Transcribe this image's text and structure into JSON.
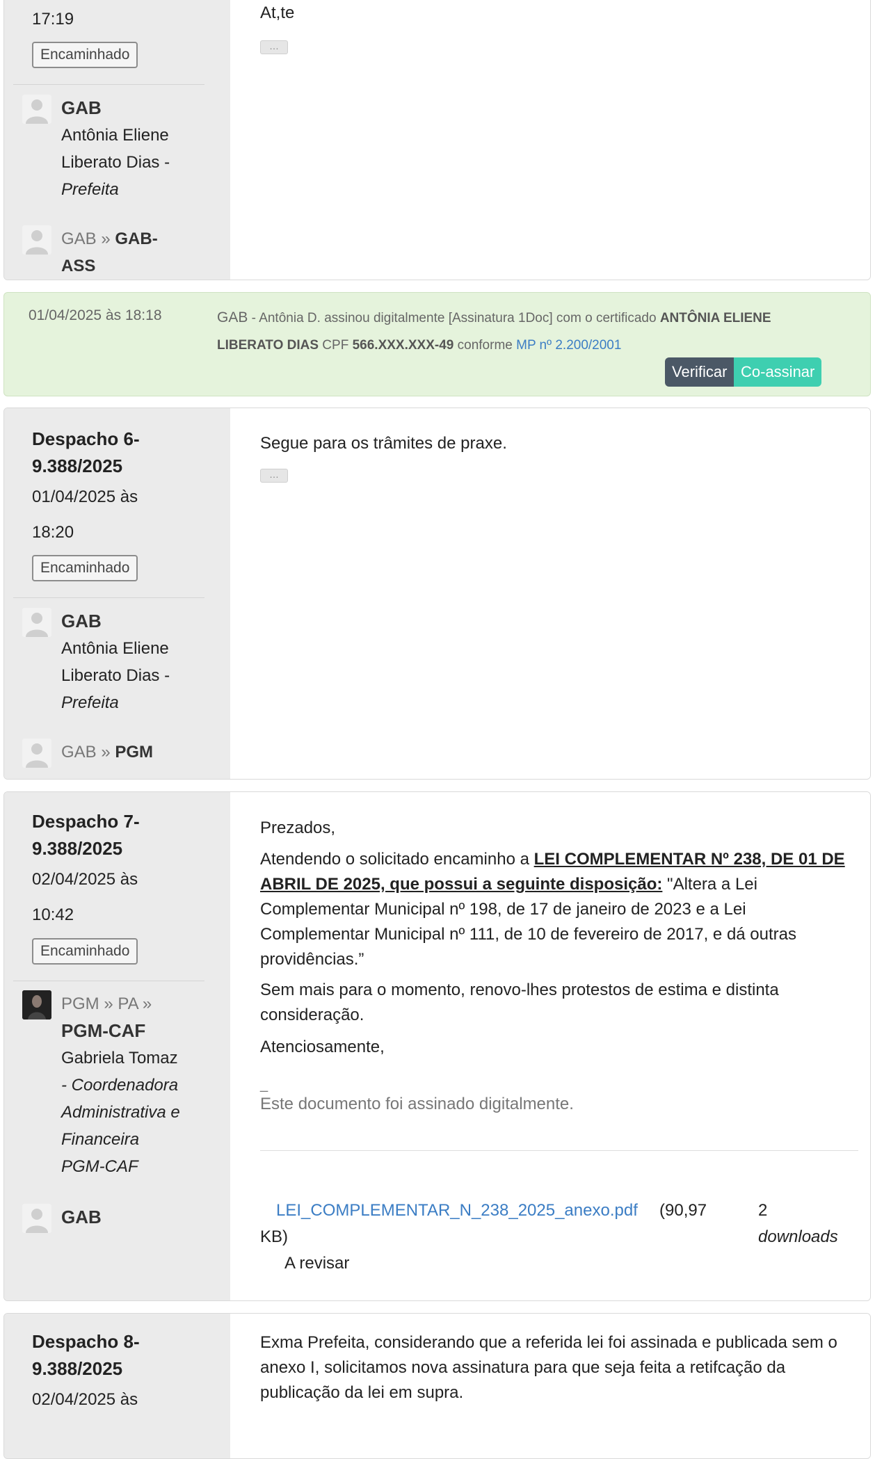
{
  "card1": {
    "time": "17:19",
    "badge": "Encaminhado",
    "sender_unit": "GAB",
    "sender_name_l1": "Antônia Eliene",
    "sender_name_l2": "Liberato Dias -",
    "sender_role": "Prefeita",
    "route_from": "GAB »",
    "route_to_l1": "GAB-",
    "route_to_l2": "ASS",
    "body_signoff": "At,te",
    "ellipsis": "…"
  },
  "signature": {
    "datetime": "01/04/2025 às 18:18",
    "unit": "GAB",
    "text_a": " - Antônia D. assinou digitalmente [Assinatura 1Doc] com o certificado ",
    "cert_name_l1": "ANTÔNIA ELIENE",
    "cert_name_l2": "LIBERATO DIAS",
    "cpf_label": " CPF ",
    "cpf": "566.XXX.XXX-49",
    "conforme": " conforme ",
    "mp_link": "MP nº 2.200/2001",
    "verify_button": "Verificar",
    "cosign_button": "Co-assinar",
    "colors": {
      "verify": "#4b5866",
      "cosign": "#3ecfb0",
      "background": "#e5f3dc"
    }
  },
  "card2": {
    "title_l1": "Despacho 6-",
    "title_l2": "9.388/2025",
    "date": "01/04/2025 às",
    "time": "18:20",
    "badge": "Encaminhado",
    "sender_unit": "GAB",
    "sender_name_l1": "Antônia Eliene",
    "sender_name_l2": "Liberato Dias -",
    "sender_role": "Prefeita",
    "route_from": "GAB »",
    "route_to": "PGM",
    "body": "Segue para os trâmites de praxe.",
    "ellipsis": "…"
  },
  "card3": {
    "title_l1": "Despacho 7-",
    "title_l2": "9.388/2025",
    "date": "02/04/2025 às",
    "time": "10:42",
    "badge": "Encaminhado",
    "sender_path": "PGM » PA »",
    "sender_unit": "PGM-CAF",
    "sender_name": "Gabriela Tomaz",
    "sender_role_l1": "- Coordenadora",
    "sender_role_l2": "Administrativa e",
    "sender_role_l3": "Financeira",
    "sender_role_l4": "PGM-CAF",
    "route_to": "GAB",
    "greeting": "Prezados,",
    "p1_a": "Atendendo o solicitado encaminho a ",
    "p1_law_l1": "LEI COMPLEMENTAR Nº 238, DE 01 DE",
    "p1_law_l2": "ABRIL DE 2025, que possui a seguinte disposição:",
    "p1_rest_l1": " \"Altera a Lei",
    "p1_rest_l2": "Complementar Municipal nº 198, de 17 de janeiro de 2023 e a Lei",
    "p1_rest_l3": "Complementar Municipal nº 111, de 10 de fevereiro de 2017, e dá outras",
    "p1_rest_l4": "providências.”",
    "p2_l1": "Sem mais para o momento, renovo-lhes protestos de estima e distinta",
    "p2_l2": "consideração.",
    "closing": "Atenciosamente,",
    "sig_dash": "_",
    "signed_note": "Este documento foi assinado digitalmente.",
    "attachment_name": "LEI_COMPLEMENTAR_N_238_2025_anexo.pdf",
    "attachment_size_a": "(90,97",
    "attachment_size_b": "KB)",
    "downloads_count": "2",
    "downloads_label": "downloads",
    "review_status": "A revisar"
  },
  "card4": {
    "title_l1": "Despacho 8-",
    "title_l2": "9.388/2025",
    "date": "02/04/2025 às",
    "body_l1": "Exma Prefeita, considerando que a referida lei foi assinada e publicada sem o",
    "body_l2": "anexo I, solicitamos nova assinatura para que seja feita a retifcação da",
    "body_l3": "publicação da lei em supra."
  }
}
